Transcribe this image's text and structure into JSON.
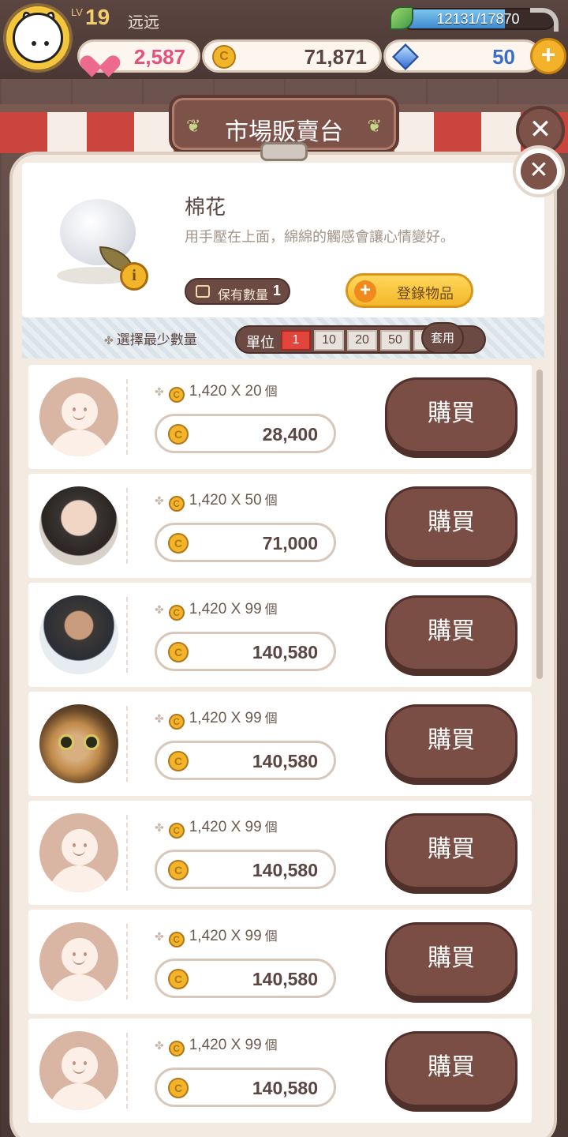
{
  "player": {
    "level_label": "LV",
    "level": "19",
    "name": "远远",
    "exp_text": "12131/17870",
    "exp_fraction": 0.679
  },
  "resources": {
    "hearts": "2,587",
    "coins": "71,871",
    "gems": "50"
  },
  "icons": {
    "coin_glyph": "C",
    "plus_glyph": "+",
    "close_glyph": "✕",
    "info_glyph": "i",
    "star_glyph": "✤"
  },
  "market": {
    "title": "市場販賣台",
    "item": {
      "name": "棉花",
      "description": "用手壓在上面，綿綿的觸感會讓心情變好。",
      "owned_label": "保有數量",
      "owned_count": "1",
      "register_label": "登錄物品"
    },
    "filter": {
      "label": "選擇最少數量",
      "unit_label": "單位",
      "options": [
        "1",
        "10",
        "20",
        "50",
        "99"
      ],
      "selected": "1",
      "apply_label": "套用"
    },
    "listings": [
      {
        "avatar": "default",
        "unit_price": "1,420",
        "qty": "20",
        "total": "28,400"
      },
      {
        "avatar": "photo1",
        "unit_price": "1,420",
        "qty": "50",
        "total": "71,000"
      },
      {
        "avatar": "photo2",
        "unit_price": "1,420",
        "qty": "99",
        "total": "140,580"
      },
      {
        "avatar": "photo3",
        "unit_price": "1,420",
        "qty": "99",
        "total": "140,580"
      },
      {
        "avatar": "default",
        "unit_price": "1,420",
        "qty": "99",
        "total": "140,580"
      },
      {
        "avatar": "default",
        "unit_price": "1,420",
        "qty": "99",
        "total": "140,580"
      },
      {
        "avatar": "default",
        "unit_price": "1,420",
        "qty": "99",
        "total": "140,580"
      }
    ],
    "times_sign": "X",
    "unit_suffix": "個",
    "buy_label": "購買"
  },
  "colors": {
    "accent_brown": "#7b4e45",
    "heart_pink": "#ec6a8c",
    "coin_gold": "#f2b52a",
    "selected_red": "#e0463c"
  }
}
